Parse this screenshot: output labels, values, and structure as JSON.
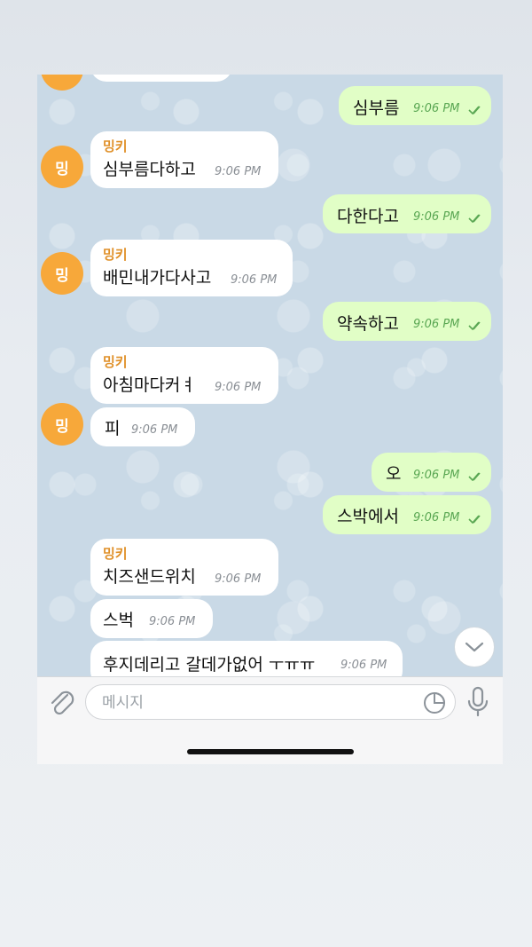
{
  "chat": {
    "messages": [
      {
        "dir": "in",
        "sender": "",
        "text": "",
        "time": "",
        "avatar": false
      },
      {
        "dir": "out",
        "text": "심부름",
        "time": "9:06 PM",
        "status": "read"
      },
      {
        "dir": "in",
        "sender": "밍키",
        "text": "심부름다하고",
        "time": "9:06 PM",
        "avatar": true,
        "avatar_text": "밍"
      },
      {
        "dir": "out",
        "text": "다한다고",
        "time": "9:06 PM",
        "status": "read"
      },
      {
        "dir": "in",
        "sender": "밍키",
        "text": "배민내가다사고",
        "time": "9:06 PM",
        "avatar": true,
        "avatar_text": "밍"
      },
      {
        "dir": "out",
        "text": "약속하고",
        "time": "9:06 PM",
        "status": "read"
      },
      {
        "dir": "in",
        "sender": "밍키",
        "text": "아침마다커ㅕ",
        "time": "9:06 PM",
        "avatar": false
      },
      {
        "dir": "in",
        "text": "피",
        "time": "9:06 PM",
        "avatar": true,
        "avatar_text": "밍"
      },
      {
        "dir": "out",
        "text": "오",
        "time": "9:06 PM",
        "status": "read"
      },
      {
        "dir": "out",
        "text": "스박에서",
        "time": "9:06 PM",
        "status": "read"
      },
      {
        "dir": "in",
        "sender": "밍키",
        "text": "치즈샌드위치",
        "time": "9:06 PM",
        "avatar": false
      },
      {
        "dir": "in",
        "text": "스벅",
        "time": "9:06 PM",
        "avatar": false
      },
      {
        "dir": "in",
        "text": "후지데리고 갈데가없어 ㅜㅠㅠ",
        "time": "9:06 PM",
        "avatar": false
      }
    ]
  },
  "composer": {
    "placeholder": "메시지",
    "icons": [
      "paperclip-icon",
      "sticker-icon",
      "microphone-icon"
    ]
  },
  "colors": {
    "incoming_bubble": "#ffffff",
    "outgoing_bubble": "#e1fec6",
    "sender_name": "#e0912a",
    "avatar": "#f7a83a",
    "read_check": "#5aa753"
  }
}
